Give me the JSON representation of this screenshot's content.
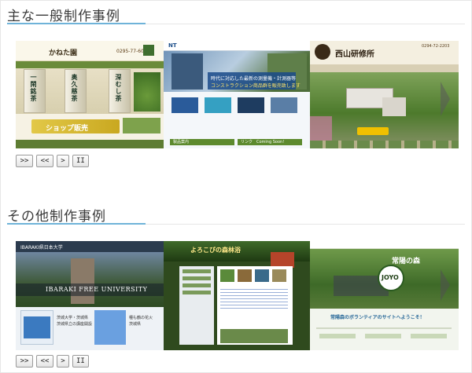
{
  "sections": [
    {
      "title": "主な一般制作事例",
      "controls": [
        ">>",
        "<<",
        ">",
        "II"
      ],
      "slides": {
        "kanekoen": {
          "shop_name": "かねた園",
          "phone": "0295-77-6011",
          "vertical_labels": [
            "一閑銘茶",
            "奥久慈茶",
            "深むし茶"
          ],
          "shop_button": "ショップ販売"
        },
        "survey": {
          "logo": "NT",
          "headline_1": "時代に対応した最新の測量機・計測器等",
          "headline_2": "コンストラクション商品群を販売致します",
          "banner_1": "製品案内",
          "banner_2": "リンク　Coming Soon!"
        },
        "shiroyama": {
          "shop_name": "西山研修所",
          "phone": "0294-72-2203"
        }
      }
    },
    {
      "title": "その他制作事例",
      "controls": [
        ">>",
        "<<",
        ">",
        "II"
      ],
      "slides": {
        "university": {
          "header": "IBARAKI県日本大学",
          "banner": "IBARAKI FREE UNIVERSITY",
          "card_1": "茨城大学・茨城県\n茨城県立の講座開設",
          "card_2": "種も鶴の花火\n茨城県"
        },
        "forest": {
          "header": "よろこびの森林浴"
        },
        "joyo": {
          "headline": "常陽の森",
          "badge": "JOYO",
          "welcome": "常陽森のボランティアのサイトへようこそ！"
        }
      }
    }
  ],
  "colors": {
    "accent_rule": "#6fb3d9",
    "title": "#3a3a3a"
  }
}
